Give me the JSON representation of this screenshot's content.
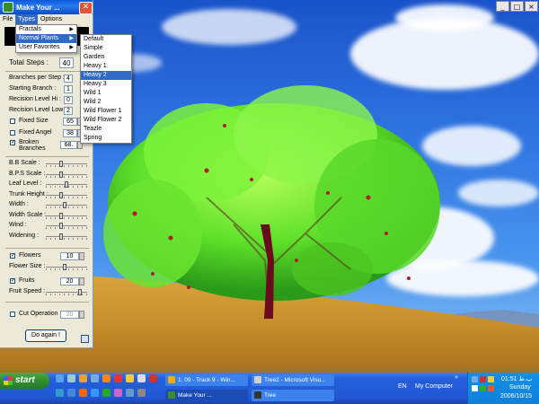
{
  "panel": {
    "title": "Make Your ...",
    "menu": [
      "File",
      "Types",
      "Options"
    ],
    "total_steps_label": "Total Steps :",
    "total_steps_value": "40",
    "fields": [
      {
        "label": "Branches per Step :",
        "value": "4"
      },
      {
        "label": "Starting Branch :",
        "value": "1"
      },
      {
        "label": "Recision Level Hi :",
        "value": "0"
      },
      {
        "label": "Recision Level Low :",
        "value": "2"
      }
    ],
    "fixed_size": {
      "label": "Fixed Size",
      "value": "65"
    },
    "fixed_angel": {
      "label": "Fixed Angel",
      "value": "38"
    },
    "broken_branches": {
      "label1": "Broken",
      "label2": "Branches",
      "value": "68.",
      "checked": true
    },
    "sliders": [
      {
        "label": "B.B Scale :",
        "level": 0.35
      },
      {
        "label": "B.P.S Scale :",
        "level": 0.35
      },
      {
        "label": "Leaf Level :",
        "level": 0.5
      },
      {
        "label": "Trunk Height :",
        "level": 0.35
      },
      {
        "label": "Width :",
        "level": 0.45
      },
      {
        "label": "Width Scale :",
        "level": 0.35
      },
      {
        "label": "Wind :",
        "level": 0.35
      },
      {
        "label": "Widening :",
        "level": 0.35
      }
    ],
    "flowers": {
      "label": "Flowers",
      "value": "10",
      "checked": true
    },
    "flower_size": {
      "label": "Flower Size :",
      "level": 0.45
    },
    "fruits": {
      "label": "Fruits",
      "value": "20",
      "checked": true
    },
    "fruit_speed": {
      "label": "Fruit Speed :",
      "level": 0.85
    },
    "cut_operation": {
      "label": "Cut Operation",
      "value": "20",
      "checked": false
    },
    "do_again": "Do again !"
  },
  "types_menu": {
    "items": [
      "Fractals",
      "Normal Plants",
      "User Favorites"
    ],
    "selected": "Normal Plants"
  },
  "plants_menu": {
    "items": [
      "Default",
      "Simple",
      "Garden",
      "Heavy 1",
      "Heavy 2",
      "Heavy 3",
      "Wild 1",
      "Wild 2",
      "Wild Flower 1",
      "Wild Flower 2",
      "Teazle",
      "Spring"
    ],
    "selected": "Heavy 2"
  },
  "taskbar": {
    "start": "start",
    "tasks": [
      "1. 09 - Track  9 - Win...",
      "Tree2 - Microsoft Visu...",
      "Make Your ...",
      "Tree"
    ],
    "lang": "EN",
    "my_computer": "My Computer",
    "time": "01:51 ب.ظ",
    "day": "Sunday",
    "date": "2006/10/15"
  },
  "colors": {
    "accent": "#316ac5",
    "title_bar": "#0a58d8",
    "start_green": "#2f8f2f"
  }
}
